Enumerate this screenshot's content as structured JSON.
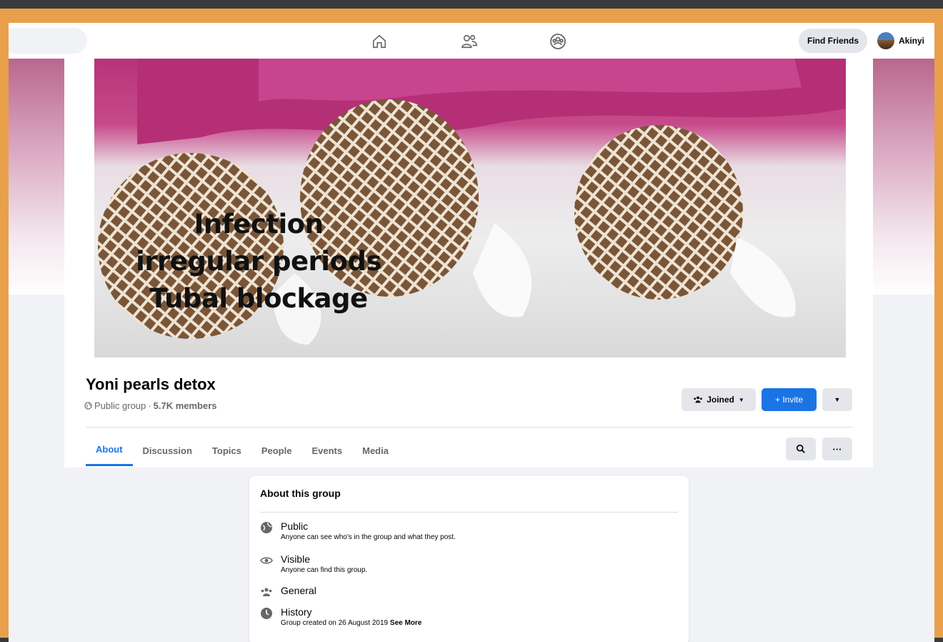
{
  "nav": {
    "home_icon": "home-icon",
    "friends_icon": "friends-icon",
    "groups_icon": "groups-icon",
    "find_friends_label": "Find Friends",
    "profile_name": "Akinyi"
  },
  "cover": {
    "lines": [
      "Infection",
      "irregular periods",
      "Tubal blockage"
    ]
  },
  "group": {
    "name": "Yoni pearls detox",
    "privacy": "Public group",
    "separator": "·",
    "members": "5.7K members",
    "joined_label": "Joined",
    "invite_label": "+ Invite"
  },
  "tabs": [
    "About",
    "Discussion",
    "Topics",
    "People",
    "Events",
    "Media"
  ],
  "about": {
    "title": "About this group",
    "rows": [
      {
        "title": "Public",
        "desc": "Anyone can see who's in the group and what they post.",
        "icon": "globe-icon"
      },
      {
        "title": "Visible",
        "desc": "Anyone can find this group.",
        "icon": "eye-icon"
      },
      {
        "title": "General",
        "desc": "",
        "icon": "people-icon"
      },
      {
        "title": "History",
        "desc": "Group created on 26 August 2019",
        "desc_link": "See More",
        "icon": "clock-icon"
      }
    ]
  },
  "colors": {
    "accent": "#1b74e4",
    "frame": "#e8a04a"
  }
}
